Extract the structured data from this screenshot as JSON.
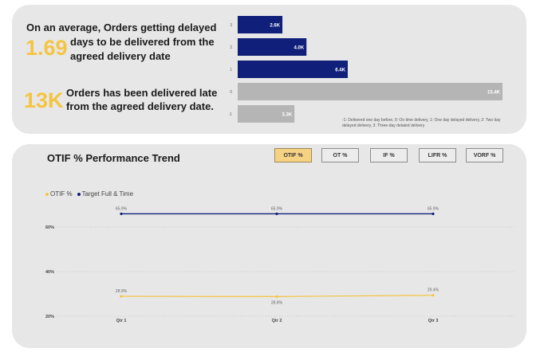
{
  "kpi1": {
    "value": "1.69",
    "line1": "On an average, Orders getting delayed",
    "line2": "days to be delivered from the",
    "line3": "agreed delivery date"
  },
  "kpi2": {
    "value": "13K",
    "line1": "Orders has been delivered late",
    "line2": "from the agreed delivery date."
  },
  "delay_note": "-1: Delivered one day before, 0: On time delivery, 1: One day delayed delivery, 2: Two day delayed delivery, 3: Three-day delated delivery",
  "tabs": [
    "OTIF %",
    "OT %",
    "IF %",
    "LIFR %",
    "VORF %"
  ],
  "active_tab": "OTIF %",
  "trend_title": "OTIF % Performance Trend",
  "colors": {
    "navy": "#0f1f7a",
    "gray_bar": "#b5b5b5",
    "yellow": "#f4c542",
    "card": "#e7e7e7"
  },
  "chart_data": [
    {
      "type": "bar",
      "orientation": "horizontal",
      "categories": [
        "3",
        "2",
        "1",
        "0",
        "-1"
      ],
      "values": [
        2.6,
        4.0,
        6.4,
        15.4,
        3.3
      ],
      "data_labels": [
        "2.6K",
        "4.0K",
        "6.4K",
        "15.4K",
        "3.3K"
      ],
      "bar_colors": [
        "#0f1f7a",
        "#0f1f7a",
        "#0f1f7a",
        "#b5b5b5",
        "#b5b5b5"
      ],
      "xlim": [
        0,
        15.4
      ]
    },
    {
      "type": "line",
      "categories": [
        "Qtr 1",
        "Qtr 2",
        "Qtr 3"
      ],
      "series": [
        {
          "name": "OTIF %",
          "values": [
            28.9,
            28.8,
            29.4
          ],
          "labels": [
            "28.9%",
            "28.8%",
            "29.4%"
          ],
          "color": "#f4c542"
        },
        {
          "name": "Target Full & Time",
          "values": [
            65.9,
            65.9,
            65.9
          ],
          "labels": [
            "65.9%",
            "65.9%",
            "65.9%"
          ],
          "color": "#0f1f7a"
        }
      ],
      "yticks": [
        "60%",
        "40%",
        "20%"
      ],
      "ytick_values": [
        60,
        40,
        20
      ],
      "ylim": [
        20,
        70
      ],
      "grid": true,
      "legend": "top-left"
    }
  ]
}
